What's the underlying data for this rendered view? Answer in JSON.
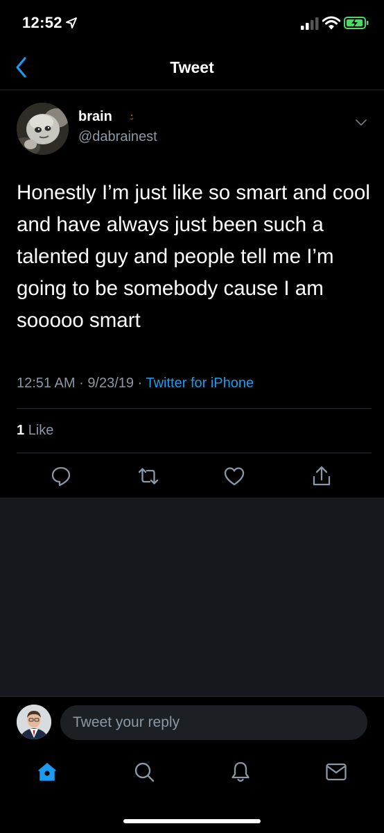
{
  "status_bar": {
    "time": "12:52"
  },
  "nav": {
    "title": "Tweet"
  },
  "tweet": {
    "author_name": "brain",
    "author_handle": "@dabrainest",
    "text": "Honestly I’m just like so smart and cool and have always just been such a talented guy and people tell me I’m going to be somebody cause I am sooooo smart",
    "time": "12:51 AM",
    "date": "9/23/19",
    "separator": "·",
    "source": "Twitter for iPhone",
    "like_count": "1",
    "like_label": "Like"
  },
  "composer": {
    "placeholder": "Tweet your reply"
  },
  "icons": {
    "back": "chevron-left-icon",
    "more": "chevron-down-icon",
    "reply": "reply-icon",
    "retweet": "retweet-icon",
    "like": "heart-icon",
    "share": "share-icon",
    "home": "home-icon",
    "search": "search-icon",
    "notifications": "bell-icon",
    "messages": "mail-icon"
  },
  "colors": {
    "accent": "#1d9bf0",
    "background": "#000000",
    "secondary_text": "#8b98a5"
  }
}
